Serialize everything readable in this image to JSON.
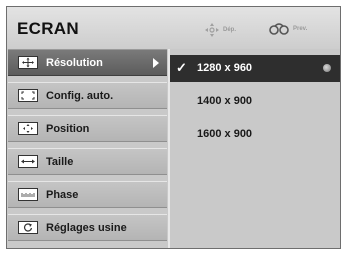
{
  "header": {
    "title": "ECRAN",
    "hints": [
      {
        "icon": "move-arrows-icon",
        "label": "Dép."
      },
      {
        "icon": "joystick-icon",
        "label": "Prev."
      }
    ]
  },
  "sidebar": {
    "items": [
      {
        "label": "Résolution",
        "icon": "resolution-icon",
        "active": true
      },
      {
        "label": "Config. auto.",
        "icon": "auto-config-icon",
        "active": false
      },
      {
        "label": "Position",
        "icon": "position-icon",
        "active": false
      },
      {
        "label": "Taille",
        "icon": "size-icon",
        "active": false
      },
      {
        "label": "Phase",
        "icon": "phase-icon",
        "active": false
      },
      {
        "label": "Réglages usine",
        "icon": "factory-reset-icon",
        "active": false
      }
    ]
  },
  "options": {
    "items": [
      {
        "label": "1280 x 960",
        "selected": true
      },
      {
        "label": "1400 x 900",
        "selected": false
      },
      {
        "label": "1600 x 900",
        "selected": false
      }
    ],
    "check_glyph": "✓"
  },
  "colors": {
    "active_bg": "#616161",
    "selected_bg": "#2e2e2e",
    "panel_bg": "#c9c9c9"
  }
}
